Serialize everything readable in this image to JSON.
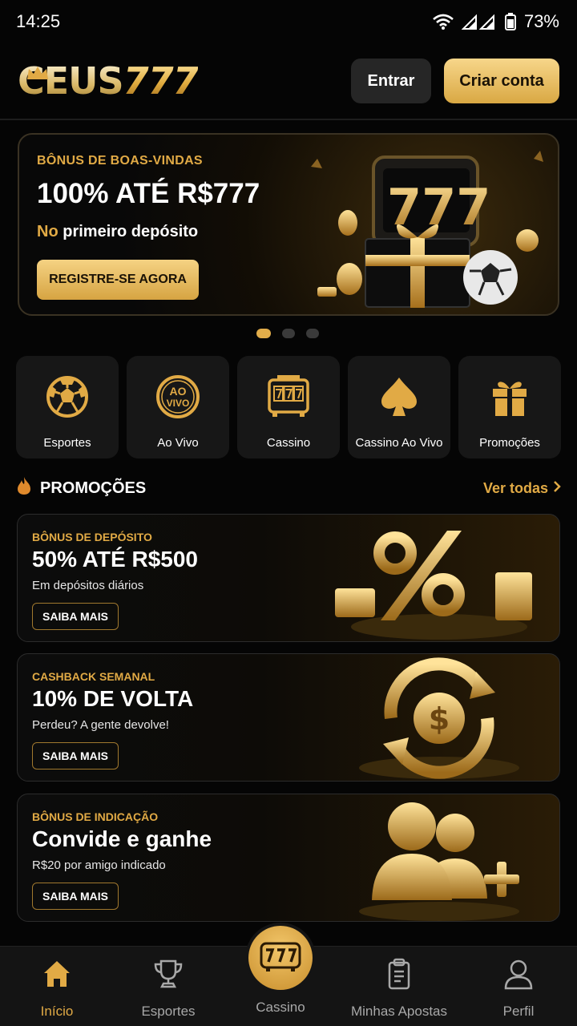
{
  "status_bar": {
    "time": "14:25",
    "battery": "73%"
  },
  "header": {
    "logo_part1": "CEUS",
    "logo_part2": "777",
    "login_label": "Entrar",
    "signup_label": "Criar conta"
  },
  "hero": {
    "eyebrow": "BÔNUS DE BOAS-VINDAS",
    "title": "100% ATÉ R$777",
    "sub_highlight": "No",
    "sub_rest": " primeiro depósito",
    "cta": "REGISTRE-SE AGORA",
    "slides": 3,
    "active_slide": 1
  },
  "categories": [
    {
      "label": "Esportes",
      "icon": "soccer-ball-icon"
    },
    {
      "label": "Ao Vivo",
      "icon": "ao-vivo-icon"
    },
    {
      "label": "Cassino",
      "icon": "slot-machine-icon"
    },
    {
      "label": "Cassino Ao Vivo",
      "icon": "spade-icon"
    },
    {
      "label": "Promoções",
      "icon": "gift-icon"
    }
  ],
  "promotions": {
    "heading": "PROMOÇÕES",
    "see_all": "Ver todas",
    "ao_vivo_icon_text": [
      "AO",
      "VIVO"
    ],
    "items": [
      {
        "eyebrow": "BÔNUS DE DEPÓSITO",
        "title": "50% ATÉ R$500",
        "desc": "Em depósitos diários",
        "button": "SAIBA MAIS",
        "icon": "percent-coins-icon"
      },
      {
        "eyebrow": "CASHBACK SEMANAL",
        "title": "10% DE VOLTA",
        "desc": "Perdeu? A gente devolve!",
        "button": "SAIBA MAIS",
        "icon": "cashback-coin-icon"
      },
      {
        "eyebrow": "BÔNUS DE INDICAÇÃO",
        "title": "Convide e ganhe",
        "desc": "R$20 por amigo indicado",
        "button": "SAIBA MAIS",
        "icon": "add-friend-icon"
      }
    ]
  },
  "bottom_nav": [
    {
      "label": "Início",
      "icon": "home-icon",
      "active": true
    },
    {
      "label": "Esportes",
      "icon": "trophy-icon",
      "active": false
    },
    {
      "label": "Cassino",
      "icon": "slot-777-icon",
      "active": false
    },
    {
      "label": "Minhas Apostas",
      "icon": "clipboard-icon",
      "active": false
    },
    {
      "label": "Perfil",
      "icon": "user-icon",
      "active": false
    }
  ],
  "colors": {
    "gold": "#e1aa45",
    "background": "#050505",
    "card": "#171717"
  }
}
